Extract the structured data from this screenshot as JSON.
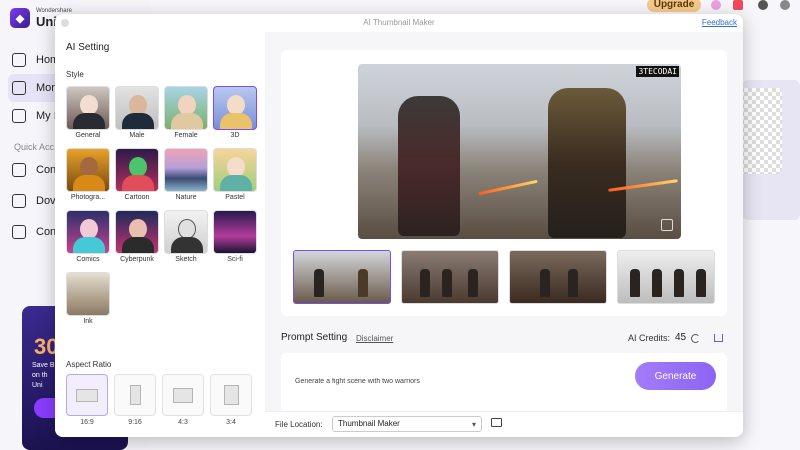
{
  "background_app": {
    "brand_small": "Wondershare",
    "brand_big": "UniC",
    "nav": [
      "Hom",
      "Mor",
      "My I"
    ],
    "quick_access": "Quick Acc",
    "nav2": [
      "Con",
      "Dov",
      "Con"
    ],
    "upgrade": "Upgrade",
    "promo": {
      "big": "30",
      "line1": "Save Bi",
      "line2": "on th",
      "line3": "Uni"
    }
  },
  "dialog": {
    "title": "AI Thumbnail Maker",
    "feedback": "Feedback"
  },
  "left": {
    "heading": "AI Setting",
    "style_label": "Style",
    "styles": [
      {
        "name": "General",
        "icon": "anime-girl-portrait"
      },
      {
        "name": "Male",
        "icon": "man-portrait"
      },
      {
        "name": "Female",
        "icon": "woman-portrait"
      },
      {
        "name": "3D",
        "icon": "3d-girl-portrait"
      },
      {
        "name": "Photogra...",
        "icon": "photo-portrait"
      },
      {
        "name": "Cartoon",
        "icon": "cartoon-character"
      },
      {
        "name": "Nature",
        "icon": "landscape"
      },
      {
        "name": "Pastel",
        "icon": "pastel-girl"
      },
      {
        "name": "Comics",
        "icon": "comic-girl"
      },
      {
        "name": "Cyberpunk",
        "icon": "cyberpunk-girl"
      },
      {
        "name": "Sketch",
        "icon": "sketch-portrait"
      },
      {
        "name": "Sci-fi",
        "icon": "scifi-room"
      },
      {
        "name": "Ink",
        "icon": "ink-landscape"
      }
    ],
    "aspect_label": "Aspect Ratio",
    "aspects": [
      "16:9",
      "9:16",
      "4:3",
      "3:4"
    ]
  },
  "right": {
    "watermark": "3TECODAI",
    "prompt_setting": "Prompt Setting",
    "disclaimer": "Disclaimer",
    "credits_label": "AI Credits:",
    "credits_value": "45",
    "prompt_text": "Generate a fight scene with two warriors",
    "generate": "Generate",
    "file_location_label": "File Location:",
    "file_location_value": "Thumbnail Maker"
  },
  "colors": {
    "accent": "#8c64f2",
    "selected_border": "#7b4df0",
    "link": "#2f6fd6"
  }
}
